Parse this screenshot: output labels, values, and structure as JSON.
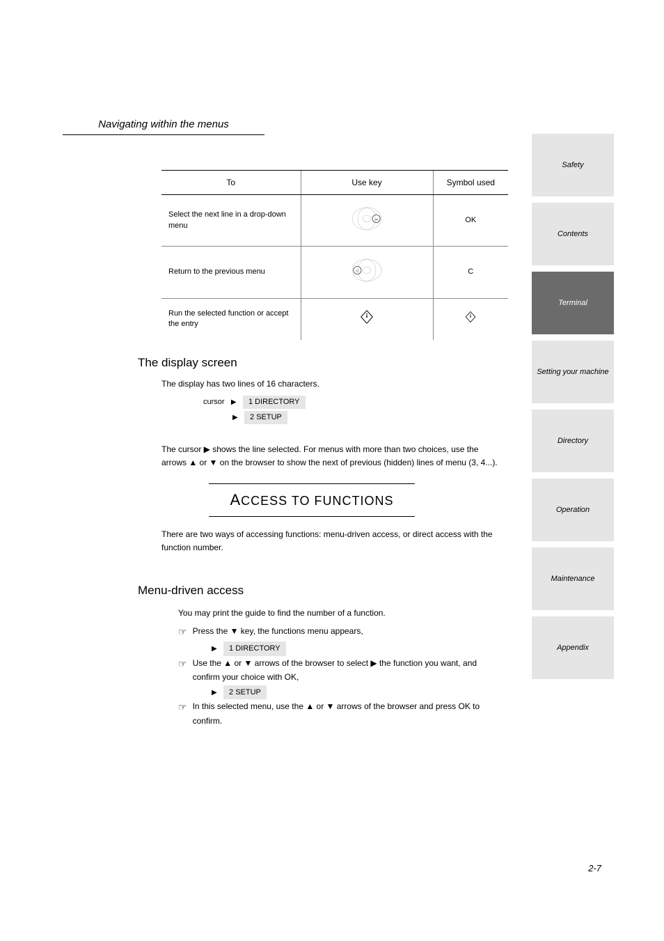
{
  "header_title": "Navigating within the menus",
  "tabs": [
    {
      "label": "Safety",
      "active": false
    },
    {
      "label": "Contents",
      "active": false
    },
    {
      "label": "Terminal",
      "active": true
    },
    {
      "label": "Setting your machine",
      "active": false
    },
    {
      "label": "Directory",
      "active": false
    },
    {
      "label": "Operation",
      "active": false
    },
    {
      "label": "Maintenance",
      "active": false
    },
    {
      "label": "Appendix",
      "active": false
    }
  ],
  "table": {
    "headers": {
      "to": "To",
      "use": "Use key",
      "sym": "Symbol used"
    },
    "rows": [
      {
        "to": "Select the next line in a drop-down menu",
        "use_icon": "nav_right_ok",
        "sym": "OK"
      },
      {
        "to": "Return to the previous menu",
        "use_icon": "nav_left_c",
        "sym": "C"
      },
      {
        "to": "Run the selected function or accept the entry",
        "use_icon": "diamond_start",
        "sym": "diamond"
      }
    ]
  },
  "display_screen": {
    "heading": "The display screen",
    "intro": "The display has two lines of 16 characters.",
    "cursor_label": "cursor",
    "ex1": "1 DIRECTORY",
    "ex2": "2 SETUP",
    "para": "The cursor ▶ shows the line selected. For menus with more than two choices, use the arrows ▲ or ▼ on the browser to show the next of previous (hidden) lines of menu (3, 4...)."
  },
  "section_heading": {
    "first": "A",
    "rest": "CCESS TO FUNCTIONS"
  },
  "access_intro": "There are two ways of accessing functions: menu-driven access, or direct access with the function number.",
  "menu_driven": {
    "heading": "Menu-driven access",
    "example_caption": "You may print the guide to find the number of a function.",
    "steps": [
      {
        "text_pre": "Press the ▼ key, the functions menu appears,",
        "ex": "1 DIRECTORY"
      },
      {
        "text_pre": "Use the ▲ or ▼ arrows of the browser to select ▶ the function you want, and confirm your choice with OK,",
        "ex": "2 SETUP"
      },
      {
        "text_pre": "In this selected menu, use the ▲ or ▼ arrows of the browser and press OK to confirm.",
        "ex": null
      }
    ]
  },
  "page_number": "2-7"
}
